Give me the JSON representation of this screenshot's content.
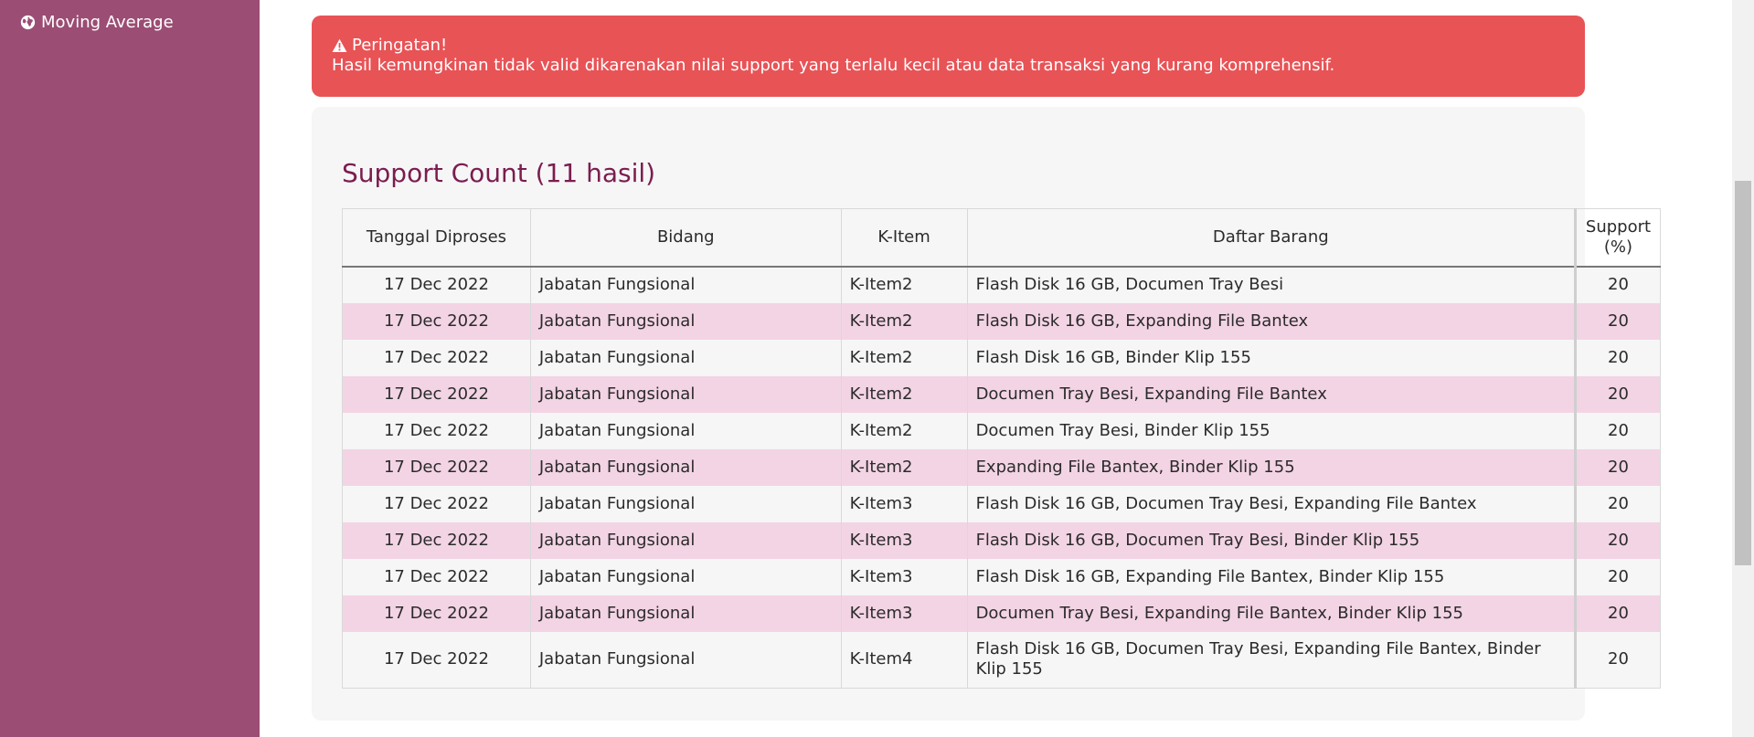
{
  "sidebar": {
    "items": [
      {
        "label": "Moving Average",
        "icon": "globe-icon"
      }
    ]
  },
  "alert": {
    "title": "Peringatan!",
    "message": "Hasil kemungkinan tidak valid dikarenakan nilai support yang terlalu kecil atau data transaksi yang kurang komprehensif.",
    "icon": "warning-icon"
  },
  "card": {
    "title": "Support Count (11 hasil)"
  },
  "table": {
    "headers": {
      "date": "Tanggal Diproses",
      "bidang": "Bidang",
      "k_item": "K-Item",
      "daftar": "Daftar Barang",
      "support": "Support (%)"
    },
    "rows": [
      {
        "date": "17 Dec 2022",
        "bidang": "Jabatan Fungsional",
        "k_item": "K-Item2",
        "daftar": "Flash Disk 16 GB, Documen Tray Besi",
        "support": "20"
      },
      {
        "date": "17 Dec 2022",
        "bidang": "Jabatan Fungsional",
        "k_item": "K-Item2",
        "daftar": "Flash Disk 16 GB, Expanding File Bantex",
        "support": "20"
      },
      {
        "date": "17 Dec 2022",
        "bidang": "Jabatan Fungsional",
        "k_item": "K-Item2",
        "daftar": "Flash Disk 16 GB, Binder Klip 155",
        "support": "20"
      },
      {
        "date": "17 Dec 2022",
        "bidang": "Jabatan Fungsional",
        "k_item": "K-Item2",
        "daftar": "Documen Tray Besi, Expanding File Bantex",
        "support": "20"
      },
      {
        "date": "17 Dec 2022",
        "bidang": "Jabatan Fungsional",
        "k_item": "K-Item2",
        "daftar": "Documen Tray Besi, Binder Klip 155",
        "support": "20"
      },
      {
        "date": "17 Dec 2022",
        "bidang": "Jabatan Fungsional",
        "k_item": "K-Item2",
        "daftar": "Expanding File Bantex, Binder Klip 155",
        "support": "20"
      },
      {
        "date": "17 Dec 2022",
        "bidang": "Jabatan Fungsional",
        "k_item": "K-Item3",
        "daftar": "Flash Disk 16 GB, Documen Tray Besi, Expanding File Bantex",
        "support": "20"
      },
      {
        "date": "17 Dec 2022",
        "bidang": "Jabatan Fungsional",
        "k_item": "K-Item3",
        "daftar": "Flash Disk 16 GB, Documen Tray Besi, Binder Klip 155",
        "support": "20"
      },
      {
        "date": "17 Dec 2022",
        "bidang": "Jabatan Fungsional",
        "k_item": "K-Item3",
        "daftar": "Flash Disk 16 GB, Expanding File Bantex, Binder Klip 155",
        "support": "20"
      },
      {
        "date": "17 Dec 2022",
        "bidang": "Jabatan Fungsional",
        "k_item": "K-Item3",
        "daftar": "Documen Tray Besi, Expanding File Bantex, Binder Klip 155",
        "support": "20"
      },
      {
        "date": "17 Dec 2022",
        "bidang": "Jabatan Fungsional",
        "k_item": "K-Item4",
        "daftar": "Flash Disk 16 GB, Documen Tray Besi, Expanding File Bantex, Binder Klip 155",
        "support": "20"
      }
    ]
  },
  "colors": {
    "sidebar": "#9b4d74",
    "alert": "#e85356",
    "title": "#7b1d4f",
    "row_stripe": "#f3d4e4"
  }
}
